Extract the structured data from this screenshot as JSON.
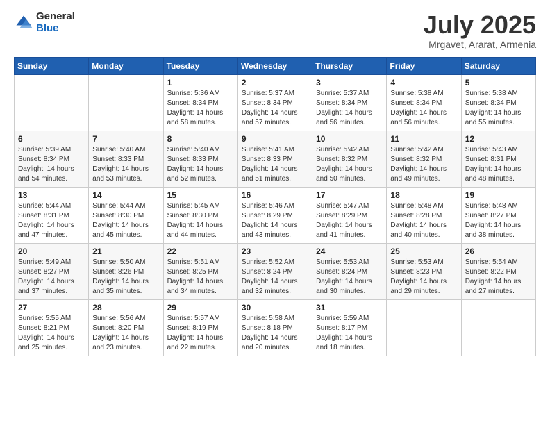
{
  "logo": {
    "general": "General",
    "blue": "Blue"
  },
  "header": {
    "title": "July 2025",
    "location": "Mrgavet, Ararat, Armenia"
  },
  "weekdays": [
    "Sunday",
    "Monday",
    "Tuesday",
    "Wednesday",
    "Thursday",
    "Friday",
    "Saturday"
  ],
  "weeks": [
    [
      {
        "day": "",
        "sunrise": "",
        "sunset": "",
        "daylight": ""
      },
      {
        "day": "",
        "sunrise": "",
        "sunset": "",
        "daylight": ""
      },
      {
        "day": "1",
        "sunrise": "Sunrise: 5:36 AM",
        "sunset": "Sunset: 8:34 PM",
        "daylight": "Daylight: 14 hours and 58 minutes."
      },
      {
        "day": "2",
        "sunrise": "Sunrise: 5:37 AM",
        "sunset": "Sunset: 8:34 PM",
        "daylight": "Daylight: 14 hours and 57 minutes."
      },
      {
        "day": "3",
        "sunrise": "Sunrise: 5:37 AM",
        "sunset": "Sunset: 8:34 PM",
        "daylight": "Daylight: 14 hours and 56 minutes."
      },
      {
        "day": "4",
        "sunrise": "Sunrise: 5:38 AM",
        "sunset": "Sunset: 8:34 PM",
        "daylight": "Daylight: 14 hours and 56 minutes."
      },
      {
        "day": "5",
        "sunrise": "Sunrise: 5:38 AM",
        "sunset": "Sunset: 8:34 PM",
        "daylight": "Daylight: 14 hours and 55 minutes."
      }
    ],
    [
      {
        "day": "6",
        "sunrise": "Sunrise: 5:39 AM",
        "sunset": "Sunset: 8:34 PM",
        "daylight": "Daylight: 14 hours and 54 minutes."
      },
      {
        "day": "7",
        "sunrise": "Sunrise: 5:40 AM",
        "sunset": "Sunset: 8:33 PM",
        "daylight": "Daylight: 14 hours and 53 minutes."
      },
      {
        "day": "8",
        "sunrise": "Sunrise: 5:40 AM",
        "sunset": "Sunset: 8:33 PM",
        "daylight": "Daylight: 14 hours and 52 minutes."
      },
      {
        "day": "9",
        "sunrise": "Sunrise: 5:41 AM",
        "sunset": "Sunset: 8:33 PM",
        "daylight": "Daylight: 14 hours and 51 minutes."
      },
      {
        "day": "10",
        "sunrise": "Sunrise: 5:42 AM",
        "sunset": "Sunset: 8:32 PM",
        "daylight": "Daylight: 14 hours and 50 minutes."
      },
      {
        "day": "11",
        "sunrise": "Sunrise: 5:42 AM",
        "sunset": "Sunset: 8:32 PM",
        "daylight": "Daylight: 14 hours and 49 minutes."
      },
      {
        "day": "12",
        "sunrise": "Sunrise: 5:43 AM",
        "sunset": "Sunset: 8:31 PM",
        "daylight": "Daylight: 14 hours and 48 minutes."
      }
    ],
    [
      {
        "day": "13",
        "sunrise": "Sunrise: 5:44 AM",
        "sunset": "Sunset: 8:31 PM",
        "daylight": "Daylight: 14 hours and 47 minutes."
      },
      {
        "day": "14",
        "sunrise": "Sunrise: 5:44 AM",
        "sunset": "Sunset: 8:30 PM",
        "daylight": "Daylight: 14 hours and 45 minutes."
      },
      {
        "day": "15",
        "sunrise": "Sunrise: 5:45 AM",
        "sunset": "Sunset: 8:30 PM",
        "daylight": "Daylight: 14 hours and 44 minutes."
      },
      {
        "day": "16",
        "sunrise": "Sunrise: 5:46 AM",
        "sunset": "Sunset: 8:29 PM",
        "daylight": "Daylight: 14 hours and 43 minutes."
      },
      {
        "day": "17",
        "sunrise": "Sunrise: 5:47 AM",
        "sunset": "Sunset: 8:29 PM",
        "daylight": "Daylight: 14 hours and 41 minutes."
      },
      {
        "day": "18",
        "sunrise": "Sunrise: 5:48 AM",
        "sunset": "Sunset: 8:28 PM",
        "daylight": "Daylight: 14 hours and 40 minutes."
      },
      {
        "day": "19",
        "sunrise": "Sunrise: 5:48 AM",
        "sunset": "Sunset: 8:27 PM",
        "daylight": "Daylight: 14 hours and 38 minutes."
      }
    ],
    [
      {
        "day": "20",
        "sunrise": "Sunrise: 5:49 AM",
        "sunset": "Sunset: 8:27 PM",
        "daylight": "Daylight: 14 hours and 37 minutes."
      },
      {
        "day": "21",
        "sunrise": "Sunrise: 5:50 AM",
        "sunset": "Sunset: 8:26 PM",
        "daylight": "Daylight: 14 hours and 35 minutes."
      },
      {
        "day": "22",
        "sunrise": "Sunrise: 5:51 AM",
        "sunset": "Sunset: 8:25 PM",
        "daylight": "Daylight: 14 hours and 34 minutes."
      },
      {
        "day": "23",
        "sunrise": "Sunrise: 5:52 AM",
        "sunset": "Sunset: 8:24 PM",
        "daylight": "Daylight: 14 hours and 32 minutes."
      },
      {
        "day": "24",
        "sunrise": "Sunrise: 5:53 AM",
        "sunset": "Sunset: 8:24 PM",
        "daylight": "Daylight: 14 hours and 30 minutes."
      },
      {
        "day": "25",
        "sunrise": "Sunrise: 5:53 AM",
        "sunset": "Sunset: 8:23 PM",
        "daylight": "Daylight: 14 hours and 29 minutes."
      },
      {
        "day": "26",
        "sunrise": "Sunrise: 5:54 AM",
        "sunset": "Sunset: 8:22 PM",
        "daylight": "Daylight: 14 hours and 27 minutes."
      }
    ],
    [
      {
        "day": "27",
        "sunrise": "Sunrise: 5:55 AM",
        "sunset": "Sunset: 8:21 PM",
        "daylight": "Daylight: 14 hours and 25 minutes."
      },
      {
        "day": "28",
        "sunrise": "Sunrise: 5:56 AM",
        "sunset": "Sunset: 8:20 PM",
        "daylight": "Daylight: 14 hours and 23 minutes."
      },
      {
        "day": "29",
        "sunrise": "Sunrise: 5:57 AM",
        "sunset": "Sunset: 8:19 PM",
        "daylight": "Daylight: 14 hours and 22 minutes."
      },
      {
        "day": "30",
        "sunrise": "Sunrise: 5:58 AM",
        "sunset": "Sunset: 8:18 PM",
        "daylight": "Daylight: 14 hours and 20 minutes."
      },
      {
        "day": "31",
        "sunrise": "Sunrise: 5:59 AM",
        "sunset": "Sunset: 8:17 PM",
        "daylight": "Daylight: 14 hours and 18 minutes."
      },
      {
        "day": "",
        "sunrise": "",
        "sunset": "",
        "daylight": ""
      },
      {
        "day": "",
        "sunrise": "",
        "sunset": "",
        "daylight": ""
      }
    ]
  ]
}
